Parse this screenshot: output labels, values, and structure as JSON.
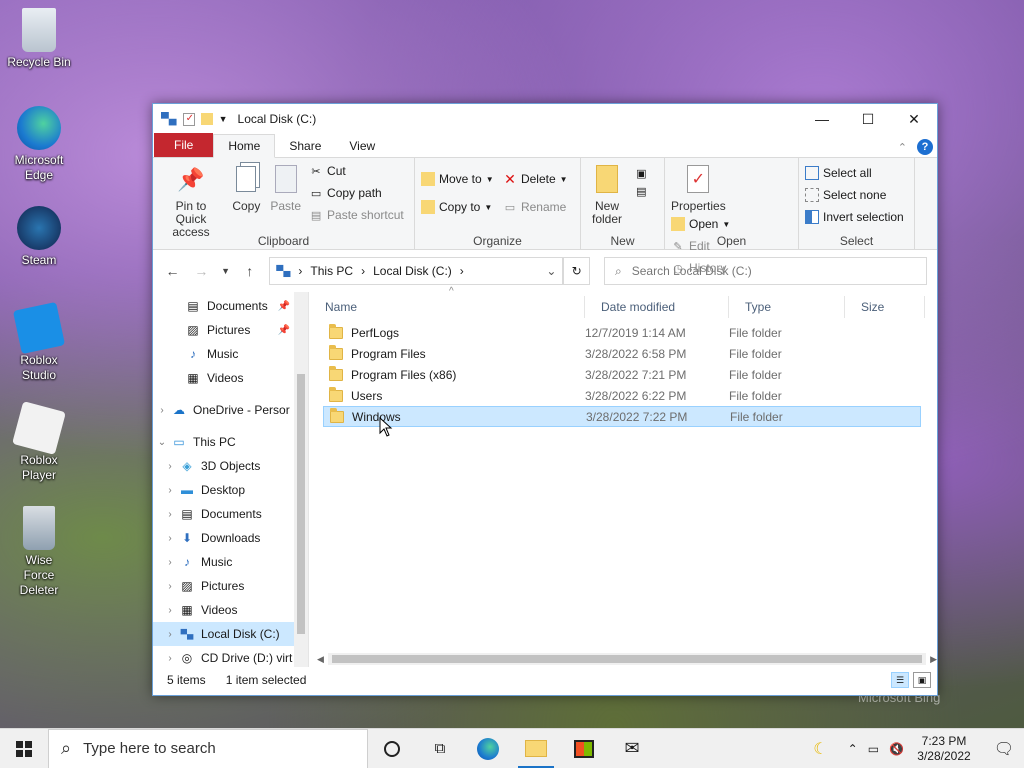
{
  "desktop": {
    "icons": [
      {
        "label": "Recycle Bin"
      },
      {
        "label": "Microsoft Edge"
      },
      {
        "label": "Steam"
      },
      {
        "label": "Roblox Studio"
      },
      {
        "label": "Roblox Player"
      },
      {
        "label": "Wise Force Deleter"
      }
    ],
    "watermark": "Microsoft Bing"
  },
  "window": {
    "title": "Local Disk (C:)",
    "tabs": {
      "file": "File",
      "home": "Home",
      "share": "Share",
      "view": "View"
    },
    "ribbon": {
      "clipboard": {
        "pin": "Pin to Quick access",
        "copy": "Copy",
        "paste": "Paste",
        "cut": "Cut",
        "copy_path": "Copy path",
        "paste_shortcut": "Paste shortcut",
        "group": "Clipboard"
      },
      "organize": {
        "move_to": "Move to",
        "copy_to": "Copy to",
        "delete": "Delete",
        "rename": "Rename",
        "group": "Organize"
      },
      "new": {
        "new_folder": "New folder",
        "group": "New"
      },
      "open": {
        "properties": "Properties",
        "open": "Open",
        "edit": "Edit",
        "history": "History",
        "group": "Open"
      },
      "select": {
        "select_all": "Select all",
        "select_none": "Select none",
        "invert": "Invert selection",
        "group": "Select"
      }
    },
    "address": {
      "crumbs": [
        "This PC",
        "Local Disk (C:)"
      ]
    },
    "search": {
      "placeholder": "Search Local Disk (C:)"
    },
    "nav": {
      "quick": [
        {
          "label": "Documents",
          "pinned": true
        },
        {
          "label": "Pictures",
          "pinned": true
        },
        {
          "label": "Music",
          "pinned": false
        },
        {
          "label": "Videos",
          "pinned": false
        }
      ],
      "onedrive": "OneDrive - Persor",
      "this_pc": "This PC",
      "pc_items": [
        "3D Objects",
        "Desktop",
        "Documents",
        "Downloads",
        "Music",
        "Pictures",
        "Videos",
        "Local Disk (C:)",
        "CD Drive (D:) virt"
      ]
    },
    "columns": {
      "name": "Name",
      "date": "Date modified",
      "type": "Type",
      "size": "Size"
    },
    "files": [
      {
        "name": "PerfLogs",
        "date": "12/7/2019 1:14 AM",
        "type": "File folder"
      },
      {
        "name": "Program Files",
        "date": "3/28/2022 6:58 PM",
        "type": "File folder"
      },
      {
        "name": "Program Files (x86)",
        "date": "3/28/2022 7:21 PM",
        "type": "File folder"
      },
      {
        "name": "Users",
        "date": "3/28/2022 6:22 PM",
        "type": "File folder"
      },
      {
        "name": "Windows",
        "date": "3/28/2022 7:22 PM",
        "type": "File folder"
      }
    ],
    "status": {
      "count": "5 items",
      "selected": "1 item selected"
    }
  },
  "taskbar": {
    "search_placeholder": "Type here to search",
    "time": "7:23 PM",
    "date": "3/28/2022"
  },
  "colors": {
    "file_tab": "#c4272f",
    "selection": "#cce8ff",
    "accent": "#1b73c7"
  }
}
